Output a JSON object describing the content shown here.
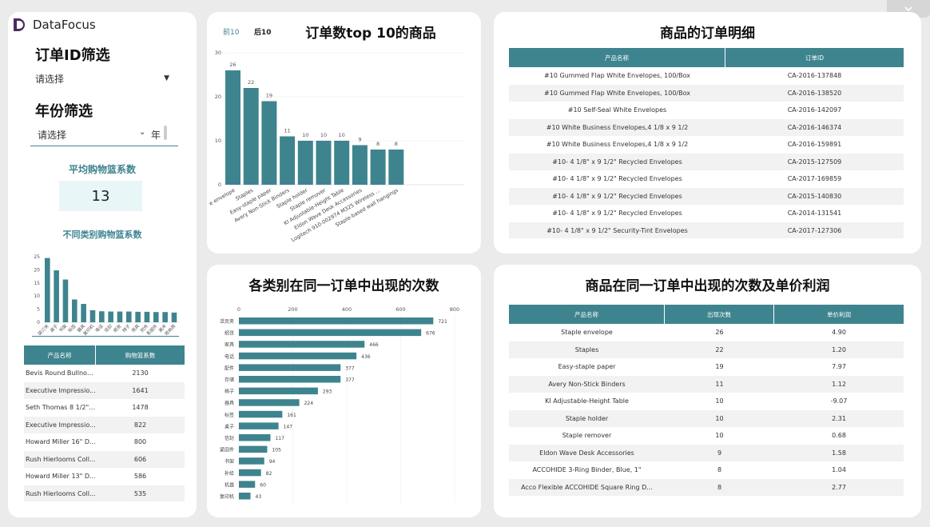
{
  "brand": {
    "name": "DataFocus"
  },
  "left": {
    "order_filter": {
      "title": "订单ID筛选",
      "placeholder": "请选择"
    },
    "year_filter": {
      "title": "年份筛选",
      "placeholder": "请选择",
      "unit": "年"
    },
    "avg_basket": {
      "title": "平均购物篮系数",
      "value": "13"
    },
    "category_chart_title": "不同类别购物篮系数",
    "category_chart": {
      "type": "bar",
      "categories": [
        "装订夹",
        "桌子",
        "书架",
        "标签",
        "器具",
        "复印机",
        "电话",
        "信封",
        "纸张",
        "椅子",
        "用具",
        "附件",
        "系固件",
        "美术",
        "收纳具"
      ],
      "values": [
        24.5,
        19.8,
        16.3,
        8.7,
        7,
        4.6,
        4.2,
        4.1,
        4.1,
        4.1,
        4,
        4,
        3.9,
        3.9,
        3.7
      ],
      "ylim": [
        0,
        25
      ],
      "yticks": [
        0,
        5,
        10,
        15,
        20,
        25
      ]
    },
    "table": {
      "headers": [
        "产品名称",
        "购物篮系数"
      ],
      "rows": [
        [
          "Bevis Round Bullnos...",
          "2130"
        ],
        [
          "Executive Impressio...",
          "1641"
        ],
        [
          "Seth Thomas 8 1/2\" ...",
          "1478"
        ],
        [
          "Executive Impressio...",
          "822"
        ],
        [
          "Howard Miller 16\" D...",
          "800"
        ],
        [
          "Rush Hierlooms Coll...",
          "606"
        ],
        [
          "Howard Miller 13\" D...",
          "586"
        ],
        [
          "Rush Hierlooms Coll...",
          "535"
        ]
      ]
    }
  },
  "top10": {
    "title": "订单数top 10的商品",
    "tabs": [
      "前10",
      "后10"
    ],
    "chart_data": {
      "type": "bar",
      "categories": [
        "Staple envelope",
        "Staples",
        "Easy-staple paper",
        "Avery Non-Stick Binders",
        "Staple holder",
        "Staple remover",
        "KI Adjustable-Height Table",
        "Eldon Wave Desk Accessories",
        "Logitech 910-002974 M325 Wireless ...",
        "Staple-based wall hangings"
      ],
      "values": [
        26,
        22,
        19,
        11,
        10,
        10,
        10,
        9,
        8,
        8
      ],
      "ylim": [
        0,
        30
      ],
      "yticks": [
        0,
        10,
        20,
        30
      ],
      "xlabels": [
        "e envelope",
        "Staples",
        "Easy-staple paper",
        "Avery Non-Stick Binders",
        "Staple holder",
        "Staple remover",
        "KI Adjustable-Height Table",
        "Eldon Wave Desk Accessories",
        "Logitech 910-002974 M325 Wireless ...",
        "Staple-based wall hangings"
      ]
    }
  },
  "order_detail": {
    "title": "商品的订单明细",
    "headers": [
      "产品名称",
      "订单ID"
    ],
    "rows": [
      [
        "#10 Gummed Flap White Envelopes, 100/Box",
        "CA-2016-137848"
      ],
      [
        "#10 Gummed Flap White Envelopes, 100/Box",
        "CA-2016-138520"
      ],
      [
        "#10 Self-Seal White Envelopes",
        "CA-2016-142097"
      ],
      [
        "#10 White Business Envelopes,4 1/8 x 9 1/2",
        "CA-2016-146374"
      ],
      [
        "#10 White Business Envelopes,4 1/8 x 9 1/2",
        "CA-2016-159891"
      ],
      [
        "#10- 4 1/8\" x 9 1/2\" Recycled Envelopes",
        "CA-2015-127509"
      ],
      [
        "#10- 4 1/8\" x 9 1/2\" Recycled Envelopes",
        "CA-2017-169859"
      ],
      [
        "#10- 4 1/8\" x 9 1/2\" Recycled Envelopes",
        "CA-2015-140830"
      ],
      [
        "#10- 4 1/8\" x 9 1/2\" Recycled Envelopes",
        "CA-2014-131541"
      ],
      [
        "#10- 4 1/8\" x 9 1/2\" Security-Tint Envelopes",
        "CA-2017-127306"
      ]
    ]
  },
  "category_count": {
    "title": "各类别在同一订单中出现的次数",
    "chart_data": {
      "type": "bar",
      "orientation": "horizontal",
      "categories": [
        "活页夹",
        "纸张",
        "家具",
        "电话",
        "配件",
        "存储",
        "椅子",
        "器具",
        "标签",
        "桌子",
        "信封",
        "紧固件",
        "书架",
        "补给",
        "机器",
        "复印机"
      ],
      "values": [
        721,
        676,
        466,
        436,
        377,
        377,
        293,
        224,
        161,
        147,
        117,
        105,
        94,
        82,
        60,
        43
      ],
      "xlim": [
        0,
        800
      ],
      "xticks": [
        0,
        200,
        400,
        600,
        800
      ]
    }
  },
  "profit_table": {
    "title": "商品在同一订单中出现的次数及单价利润",
    "headers": [
      "产品名称",
      "出现次数",
      "单价利润"
    ],
    "rows": [
      [
        "Staple envelope",
        "26",
        "4.90"
      ],
      [
        "Staples",
        "22",
        "1.20"
      ],
      [
        "Easy-staple paper",
        "19",
        "7.97"
      ],
      [
        "Avery Non-Stick Binders",
        "11",
        "1.12"
      ],
      [
        "KI Adjustable-Height Table",
        "10",
        "-9.07"
      ],
      [
        "Staple holder",
        "10",
        "2.31"
      ],
      [
        "Staple remover",
        "10",
        "0.68"
      ],
      [
        "Eldon Wave Desk Accessories",
        "9",
        "1.58"
      ],
      [
        "ACCOHIDE 3-Ring Binder, Blue, 1\"",
        "8",
        "1.04"
      ],
      [
        "Acco Flexible ACCOHIDE Square Ring D...",
        "8",
        "2.77"
      ]
    ]
  },
  "colors": {
    "accent": "#3e848f",
    "bar": "#3e848f",
    "highlight_bg": "#e8f6f7"
  },
  "icons": {
    "dropdown": "caret-down-icon",
    "collapse": "chevron-down-icon"
  }
}
